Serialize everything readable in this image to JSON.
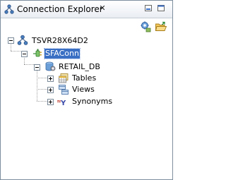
{
  "view": {
    "title": "Connection Explorer",
    "close_glyph": "✕",
    "icon": "connection-explorer-icon"
  },
  "toolbar": {
    "buttons": [
      {
        "name": "connect-icon"
      },
      {
        "name": "open-folder-icon"
      }
    ]
  },
  "tree": {
    "server": {
      "label": "TSVR28X64D2",
      "icon": "server-network-icon"
    },
    "connection": {
      "label": "SFAConn",
      "icon": "connection-plug-icon",
      "selected": true
    },
    "database": {
      "label": "RETAIL_DB",
      "icon": "database-icon"
    },
    "children": [
      {
        "label": "Tables",
        "icon": "tables-icon"
      },
      {
        "label": "Views",
        "icon": "views-icon"
      },
      {
        "label": "Synonyms",
        "icon": "synonyms-icon"
      }
    ]
  },
  "colors": {
    "selection": "#3a6fc4",
    "frame_border": "#7d8e9e"
  }
}
